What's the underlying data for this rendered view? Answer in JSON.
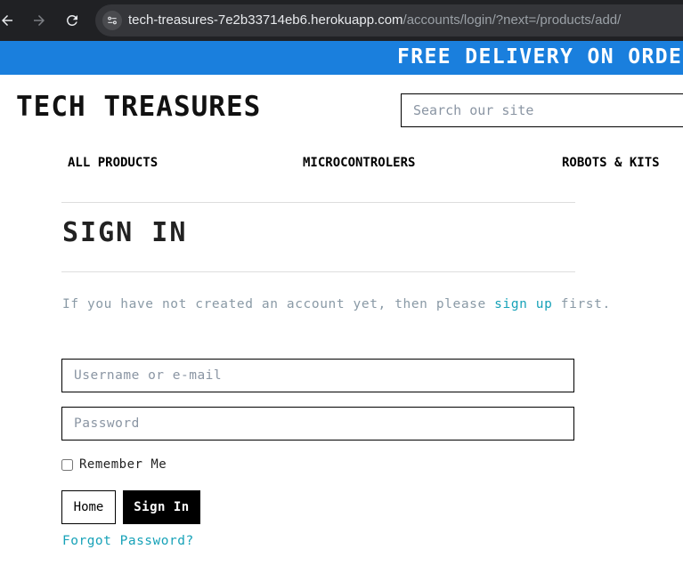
{
  "browser": {
    "icons": {
      "back": "arrow-left-icon",
      "forward": "arrow-right-icon",
      "reload": "reload-icon",
      "site_info": "tune-icon"
    },
    "url_host": "tech-treasures-7e2b33714eb6.herokuapp.com",
    "url_path": "/accounts/login/?next=/products/add/"
  },
  "banner": {
    "text": "FREE DELIVERY ON ORDERS O",
    "color": "#1a7fdd"
  },
  "header": {
    "brand": "TECH TREASURES",
    "search_placeholder": "Search our site"
  },
  "nav": {
    "items": [
      {
        "label": "ALL PRODUCTS"
      },
      {
        "label": "MICROCONTROLERS"
      },
      {
        "label": "ROBOTS & KITS"
      }
    ]
  },
  "main": {
    "title": "SIGN IN",
    "intro_before": "If you have not created an account yet, then please ",
    "intro_link": "sign up",
    "intro_after": " first.",
    "username_placeholder": "Username or e-mail",
    "password_placeholder": "Password",
    "remember_label": "Remember Me",
    "home_button": "Home",
    "signin_button": "Sign In",
    "forgot_link": "Forgot Password?",
    "link_color": "#17a2b8"
  }
}
